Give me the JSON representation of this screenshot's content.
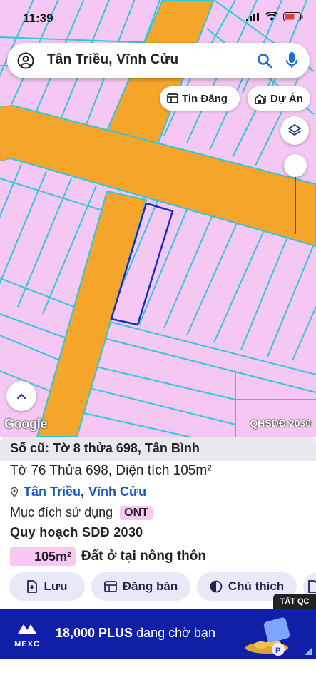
{
  "status_bar": {
    "time": "11:39"
  },
  "search": {
    "query": "Tân Triều, Vĩnh Cửu"
  },
  "chips": {
    "tin_dang": "Tin Đăng",
    "du_an": "Dự Án"
  },
  "map": {
    "attribution": "Google",
    "layer_label": "QHSDĐ 2030",
    "colors": {
      "residential": "#f4c8f2",
      "road": "#f5a52a",
      "parcel_line": "#2fc8d8",
      "selected_outline": "#1a2dbf"
    }
  },
  "parcel": {
    "old_info": "Số cũ: Tờ 8 thửa 698, Tân Bình",
    "line": "Tờ 76 Thửa 698, Diện tích 105m²",
    "commune": "Tân Triều",
    "separator": ",",
    "district": "Vĩnh Cửu",
    "purpose_label": "Mục đích sử dụng",
    "purpose_code": "ONT",
    "plan_title": "Quy hoạch SDĐ 2030",
    "plan_area": "105m²",
    "plan_type": "Đất ở tại nông thôn"
  },
  "actions": {
    "save": "Lưu",
    "sell": "Đăng bán",
    "legend": "Chú thích"
  },
  "ad": {
    "close_label": "TẮT QC",
    "brand": "MEXC",
    "text_highlight": "18,000 PLUS",
    "text_rest": " đang chờ bạn"
  }
}
